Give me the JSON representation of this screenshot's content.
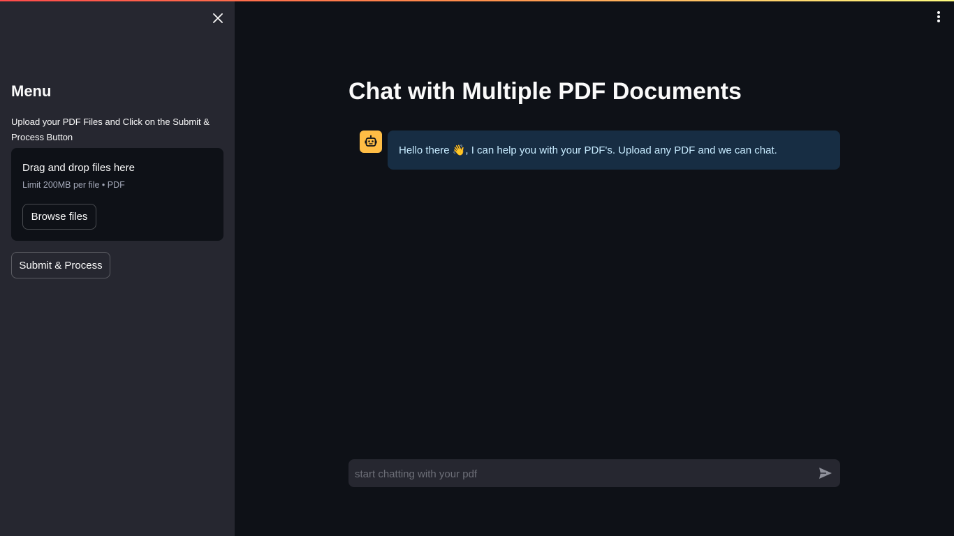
{
  "sidebar": {
    "heading": "Menu",
    "instructions": "Upload your PDF Files and Click on the Submit & Process Button",
    "uploader": {
      "title": "Drag and drop files here",
      "limit": "Limit 200MB per file • PDF",
      "browse_label": "Browse files"
    },
    "submit_label": "Submit & Process",
    "close_icon": "close-icon"
  },
  "header": {
    "menu_icon": "more-vertical-icon"
  },
  "main": {
    "title": "Chat with Multiple PDF Documents",
    "messages": [
      {
        "role": "assistant",
        "avatar_icon": "robot-icon",
        "text": "Hello there 👋, I can help you with your PDF's. Upload any PDF and we can chat."
      }
    ],
    "chat_input": {
      "placeholder": "start chatting with your pdf",
      "value": "",
      "send_icon": "send-icon"
    }
  },
  "colors": {
    "background": "#0e1117",
    "sidebar_bg": "#262730",
    "assistant_avatar": "#ffbd45",
    "assistant_bubble": "#172d43",
    "assistant_text": "#c7ebff"
  }
}
